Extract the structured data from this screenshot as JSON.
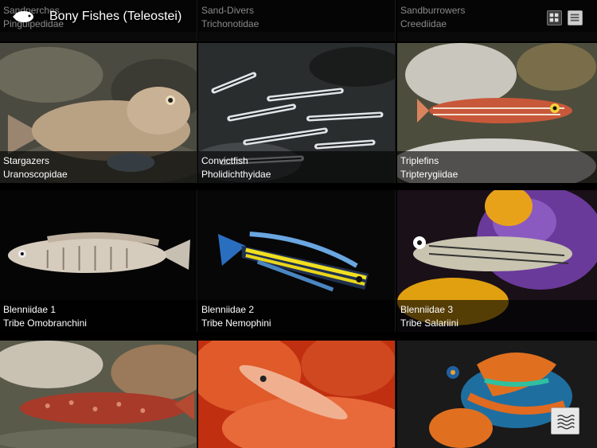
{
  "app": {
    "title": "Bony Fishes (Teleostei)"
  },
  "header": {
    "logo_icon": "fish-logo-icon",
    "grid_view_icon": "grid-view-icon",
    "list_view_icon": "list-view-icon"
  },
  "top_partial_row": [
    {
      "name": "Sandperches",
      "family": "Pinguipedidae"
    },
    {
      "name": "Sand-Divers",
      "family": "Trichonotidae"
    },
    {
      "name": "Sandburrowers",
      "family": "Creediidae"
    }
  ],
  "tiles": [
    {
      "name": "Stargazers",
      "family": "Uranoscopidae"
    },
    {
      "name": "Convictfish",
      "family": "Pholidichthyidae"
    },
    {
      "name": "Triplefins",
      "family": "Tripterygiidae"
    },
    {
      "name": "Blenniidae 1",
      "family": "Tribe Omobranchini"
    },
    {
      "name": "Blenniidae 2",
      "family": "Tribe Nemophini"
    },
    {
      "name": "Blenniidae 3",
      "family": "Tribe Salariini"
    }
  ],
  "bottom_partial_row": [
    {
      "image": "spotted-red-fish-photo"
    },
    {
      "image": "orange-goby-photo"
    },
    {
      "image": "mandarinfish-photo"
    }
  ],
  "float_button": {
    "icon": "waves-icon"
  },
  "colors": {
    "background": "#000000",
    "caption_bg": "rgba(0,0,0,0.62)"
  }
}
